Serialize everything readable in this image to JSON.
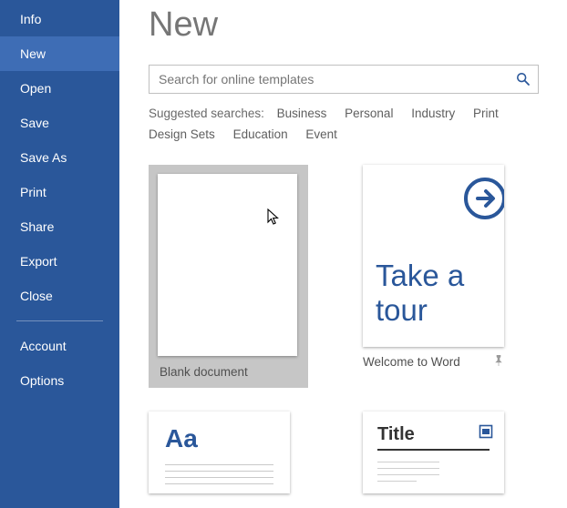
{
  "sidebar": {
    "items": [
      {
        "label": "Info"
      },
      {
        "label": "New"
      },
      {
        "label": "Open"
      },
      {
        "label": "Save"
      },
      {
        "label": "Save As"
      },
      {
        "label": "Print"
      },
      {
        "label": "Share"
      },
      {
        "label": "Export"
      },
      {
        "label": "Close"
      }
    ],
    "footer": [
      {
        "label": "Account"
      },
      {
        "label": "Options"
      }
    ],
    "selected_index": 1
  },
  "page": {
    "title": "New"
  },
  "search": {
    "placeholder": "Search for online templates"
  },
  "suggested": {
    "label": "Suggested searches:",
    "links": [
      "Business",
      "Personal",
      "Industry",
      "Print",
      "Design Sets",
      "Education",
      "Event"
    ]
  },
  "templates": [
    {
      "label": "Blank document",
      "kind": "blank",
      "selected": true
    },
    {
      "label": "Welcome to Word",
      "kind": "tour",
      "pinned": true,
      "tour_text": "Take a tour"
    },
    {
      "label": "",
      "kind": "aa",
      "aa_text": "Aa"
    },
    {
      "label": "",
      "kind": "title",
      "title_text": "Title"
    }
  ],
  "colors": {
    "accent": "#2a579a"
  }
}
